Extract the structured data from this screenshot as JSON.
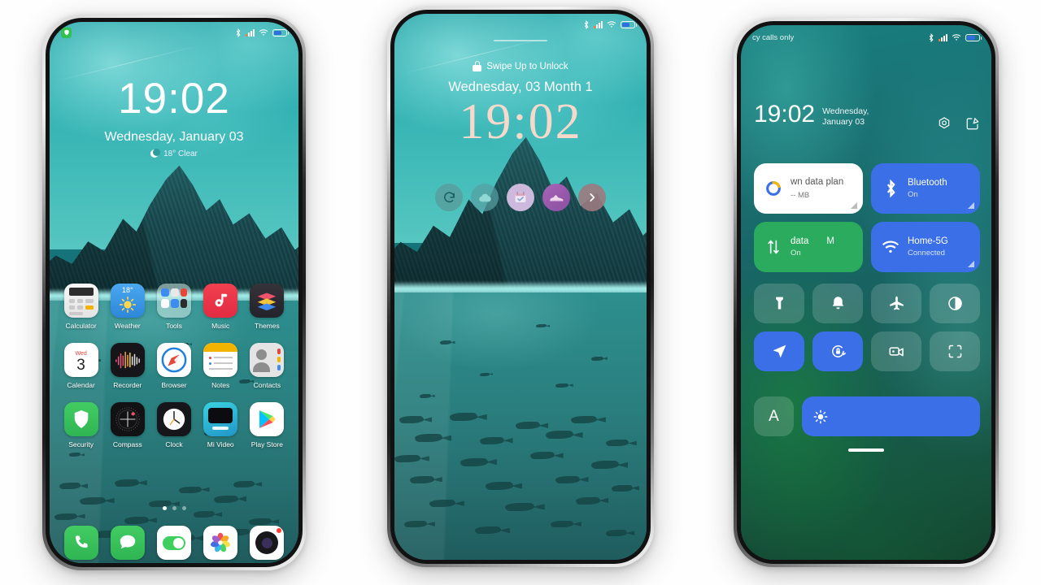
{
  "scene": {
    "background_color": "#ffffff",
    "phone_count": 3
  },
  "phone1": {
    "name": "home-screen",
    "statusbar": {
      "badge_icon": "security-shield-notification",
      "icons": [
        "bluetooth-icon",
        "signal-bars-icon",
        "wifi-icon",
        "battery-icon"
      ]
    },
    "clock": {
      "time": "19:02",
      "date": "Wednesday, January 03"
    },
    "weather": {
      "icon": "moon-clear-icon",
      "text": "18° Clear"
    },
    "apps": [
      {
        "label": "Calculator",
        "icon": "calculator-icon"
      },
      {
        "label": "Weather",
        "icon": "weather-icon",
        "badge": "18°"
      },
      {
        "label": "Tools",
        "icon": "folder-tools-icon"
      },
      {
        "label": "Music",
        "icon": "music-icon"
      },
      {
        "label": "Themes",
        "icon": "themes-icon"
      },
      {
        "label": "Calendar",
        "icon": "calendar-icon",
        "day_name": "Wed",
        "day_num": "3"
      },
      {
        "label": "Recorder",
        "icon": "recorder-icon"
      },
      {
        "label": "Browser",
        "icon": "browser-compass-icon"
      },
      {
        "label": "Notes",
        "icon": "notes-icon"
      },
      {
        "label": "Contacts",
        "icon": "contacts-icon"
      },
      {
        "label": "Security",
        "icon": "security-shield-icon"
      },
      {
        "label": "Compass",
        "icon": "compass-icon"
      },
      {
        "label": "Clock",
        "icon": "clock-icon"
      },
      {
        "label": "Mi Video",
        "icon": "mi-video-icon"
      },
      {
        "label": "Play Store",
        "icon": "play-store-icon"
      }
    ],
    "page_dots": {
      "count": 3,
      "active_index": 0
    },
    "dock": [
      {
        "name": "phone-app",
        "icon": "phone-handset-icon"
      },
      {
        "name": "messages-app",
        "icon": "message-bubble-icon"
      },
      {
        "name": "settings-app",
        "icon": "toggle-switch-icon"
      },
      {
        "name": "photos-app",
        "icon": "photos-flower-icon"
      },
      {
        "name": "camera-app",
        "icon": "camera-lens-icon",
        "badge": true
      }
    ]
  },
  "phone2": {
    "name": "lock-screen",
    "statusbar": {
      "icons": [
        "bluetooth-icon",
        "signal-bars-icon",
        "wifi-icon",
        "battery-icon"
      ]
    },
    "swipe_hint": "Swipe Up to Unlock",
    "lock_icon": "padlock-icon",
    "date": "Wednesday, 03 Month 1",
    "time": "19:02",
    "shortcuts": [
      {
        "name": "sync-shortcut",
        "icon": "refresh-person-icon",
        "color": "#5a9a9a"
      },
      {
        "name": "weather-shortcut",
        "icon": "cloud-icon",
        "color": "#56a0a2"
      },
      {
        "name": "calendar-shortcut",
        "icon": "calendar-check-icon",
        "color": "#c8b6d8"
      },
      {
        "name": "fitness-shortcut",
        "icon": "sneaker-icon",
        "color": "#9a5fa8"
      },
      {
        "name": "more-shortcut",
        "icon": "chevron-right-icon",
        "color": "#9b7a80"
      }
    ]
  },
  "phone3": {
    "name": "control-center",
    "statusbar": {
      "carrier_text": "cy calls only",
      "icons": [
        "bluetooth-icon",
        "signal-bars-icon",
        "wifi-icon",
        "battery-icon"
      ]
    },
    "header": {
      "time": "19:02",
      "date": "Wednesday, January 03",
      "actions": [
        {
          "name": "settings-gear-button",
          "icon": "gear-hex-icon"
        },
        {
          "name": "edit-button",
          "icon": "edit-pencil-icon"
        }
      ]
    },
    "tiles": [
      {
        "name": "data-plan-tile",
        "title": "wn data plan",
        "subtitle": "-- MB",
        "icon": "data-ring-icon",
        "style": "white",
        "resize": true
      },
      {
        "name": "bluetooth-tile",
        "title": "Bluetooth",
        "subtitle": "On",
        "icon": "bluetooth-icon",
        "style": "blue",
        "resize": true
      },
      {
        "name": "mobile-data-tile",
        "title": "data",
        "title_extra": "M",
        "subtitle": "On",
        "icon": "data-arrows-icon",
        "style": "green",
        "resize": false
      },
      {
        "name": "wifi-tile",
        "title": "Home-5G",
        "subtitle": "Connected",
        "icon": "wifi-icon",
        "style": "blue",
        "resize": true
      }
    ],
    "quick_settings": [
      {
        "name": "flashlight-toggle",
        "icon": "flashlight-icon",
        "active": false
      },
      {
        "name": "ringer-toggle",
        "icon": "bell-icon",
        "active": false
      },
      {
        "name": "airplane-mode-toggle",
        "icon": "airplane-icon",
        "active": false
      },
      {
        "name": "dark-mode-toggle",
        "icon": "contrast-circle-icon",
        "active": false
      },
      {
        "name": "location-toggle",
        "icon": "location-arrow-icon",
        "active": true
      },
      {
        "name": "rotation-lock-toggle",
        "icon": "rotation-lock-icon",
        "active": true
      },
      {
        "name": "screen-recorder-toggle",
        "icon": "video-camera-icon",
        "active": false
      },
      {
        "name": "scanner-toggle",
        "icon": "scan-frame-icon",
        "active": false
      }
    ],
    "bottom_row": {
      "font_button": {
        "name": "font-size-button",
        "label": "A"
      },
      "brightness_slider": {
        "name": "brightness-slider",
        "icon": "brightness-sun-icon",
        "value_percent": 100
      }
    },
    "home_indicator": true
  },
  "colors": {
    "accent_blue": "#3a6fe8",
    "accent_green": "#2bab5d",
    "teal_wallpaper": "#2f9b9c",
    "lock_clock_cream": "#f7d9cc",
    "status_orange": "#ff7a2f"
  }
}
